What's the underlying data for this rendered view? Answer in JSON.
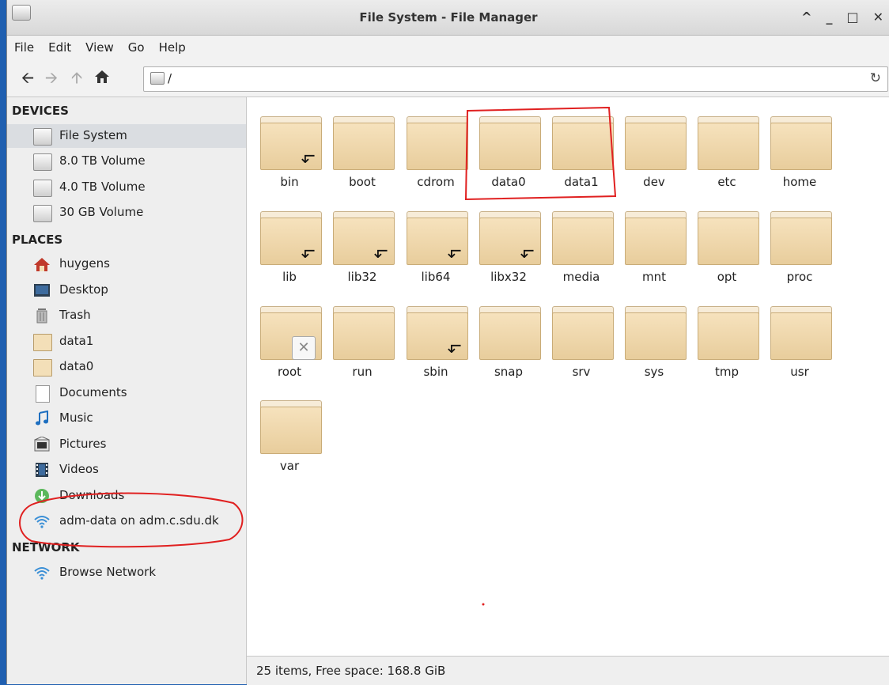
{
  "window": {
    "title": "File System - File Manager"
  },
  "window_buttons": [
    "^",
    "_",
    "□",
    "✕"
  ],
  "menu": [
    "File",
    "Edit",
    "View",
    "Go",
    "Help"
  ],
  "location": {
    "path": "/"
  },
  "sidebar": {
    "devices_header": "DEVICES",
    "devices": [
      "File System",
      "8.0 TB Volume",
      "4.0 TB Volume",
      "30 GB Volume"
    ],
    "places_header": "PLACES",
    "places": [
      "huygens",
      "Desktop",
      "Trash",
      "data1",
      "data0",
      "Documents",
      "Music",
      "Pictures",
      "Videos",
      "Downloads",
      "adm-data on adm.c.sdu.dk"
    ],
    "network_header": "NETWORK",
    "network": [
      "Browse Network"
    ]
  },
  "folders": [
    {
      "name": "bin",
      "link": true
    },
    {
      "name": "boot"
    },
    {
      "name": "cdrom"
    },
    {
      "name": "data0"
    },
    {
      "name": "data1"
    },
    {
      "name": "dev"
    },
    {
      "name": "etc"
    },
    {
      "name": "home"
    },
    {
      "name": "lib",
      "link": true
    },
    {
      "name": "lib32",
      "link": true
    },
    {
      "name": "lib64",
      "link": true
    },
    {
      "name": "libx32",
      "link": true
    },
    {
      "name": "media"
    },
    {
      "name": "mnt"
    },
    {
      "name": "opt"
    },
    {
      "name": "proc"
    },
    {
      "name": "root",
      "locked": true
    },
    {
      "name": "run"
    },
    {
      "name": "sbin",
      "link": true
    },
    {
      "name": "snap"
    },
    {
      "name": "srv"
    },
    {
      "name": "sys"
    },
    {
      "name": "tmp"
    },
    {
      "name": "usr"
    },
    {
      "name": "var"
    }
  ],
  "status": {
    "text": "25 items, Free space: 168.8 GiB"
  },
  "colors": {
    "annotation": "#e02020",
    "selected_row": "#dadde1",
    "folder": "#f0d8aa"
  }
}
